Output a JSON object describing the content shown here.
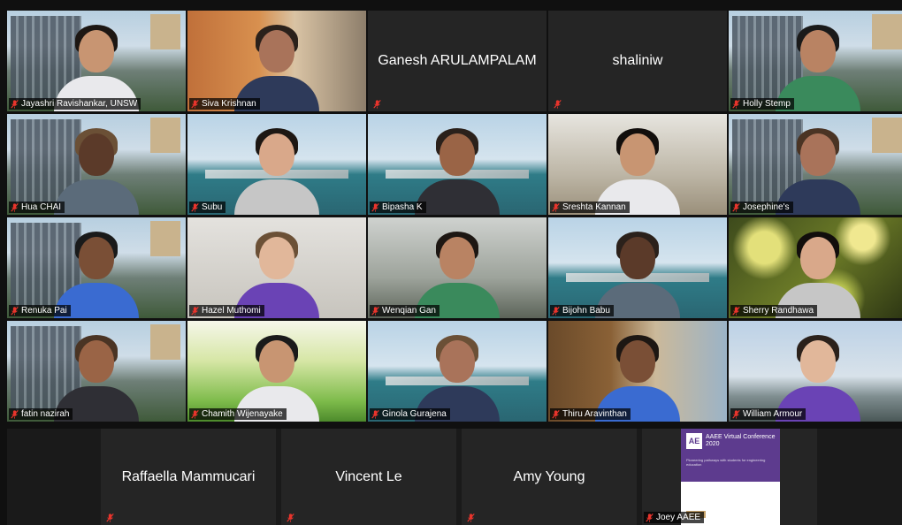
{
  "participants": [
    {
      "name": "Jayashri Ravishankar, UNSW",
      "video": true,
      "bg": "campus",
      "active": true
    },
    {
      "name": "Siva Krishnan",
      "video": true,
      "bg": "office"
    },
    {
      "name": "Ganesh ARULAMPALAM",
      "video": false
    },
    {
      "name": "shaliniw",
      "video": false
    },
    {
      "name": "Holly Stemp",
      "video": true,
      "bg": "campus"
    },
    {
      "name": "Hua CHAI",
      "video": true,
      "bg": "campus"
    },
    {
      "name": "Subu",
      "video": true,
      "bg": "harbour"
    },
    {
      "name": "Bipasha K",
      "video": true,
      "bg": "harbour"
    },
    {
      "name": "Sreshta Kannan",
      "video": true,
      "bg": "rock"
    },
    {
      "name": "Josephine's",
      "video": true,
      "bg": "campus"
    },
    {
      "name": "Renuka Pai",
      "video": true,
      "bg": "campus"
    },
    {
      "name": "Hazel Muthomi",
      "video": true,
      "bg": "wall"
    },
    {
      "name": "Wenqian Gan",
      "video": true,
      "bg": "room"
    },
    {
      "name": "Bijohn Babu",
      "video": true,
      "bg": "harbour"
    },
    {
      "name": "Sherry Randhawa",
      "video": true,
      "bg": "bokeh"
    },
    {
      "name": "fatin nazirah",
      "video": true,
      "bg": "campus"
    },
    {
      "name": "Chamith Wijenayake",
      "video": true,
      "bg": "grass"
    },
    {
      "name": "Ginola Gurajena",
      "video": true,
      "bg": "harbour"
    },
    {
      "name": "Thiru Aravinthan",
      "video": true,
      "bg": "books"
    },
    {
      "name": "William Armour",
      "video": true,
      "bg": "city"
    }
  ],
  "bottom_row": [
    {
      "name": "Raffaella Mammucari",
      "video": false
    },
    {
      "name": "Vincent Le",
      "video": false
    },
    {
      "name": "Amy Young",
      "video": false
    },
    {
      "name": "Joey AAEE",
      "video": "slide"
    }
  ],
  "slide": {
    "logo": "AE",
    "title": "AAEE Virtual Conference 2020",
    "subtitle": "Pioneering pathways with students for engineering education"
  },
  "colors": {
    "muted_mic": "#e8342c",
    "active_outline": "#cfe25a",
    "background": "#101010"
  },
  "icons": {
    "muted": "mic-muted-icon"
  }
}
